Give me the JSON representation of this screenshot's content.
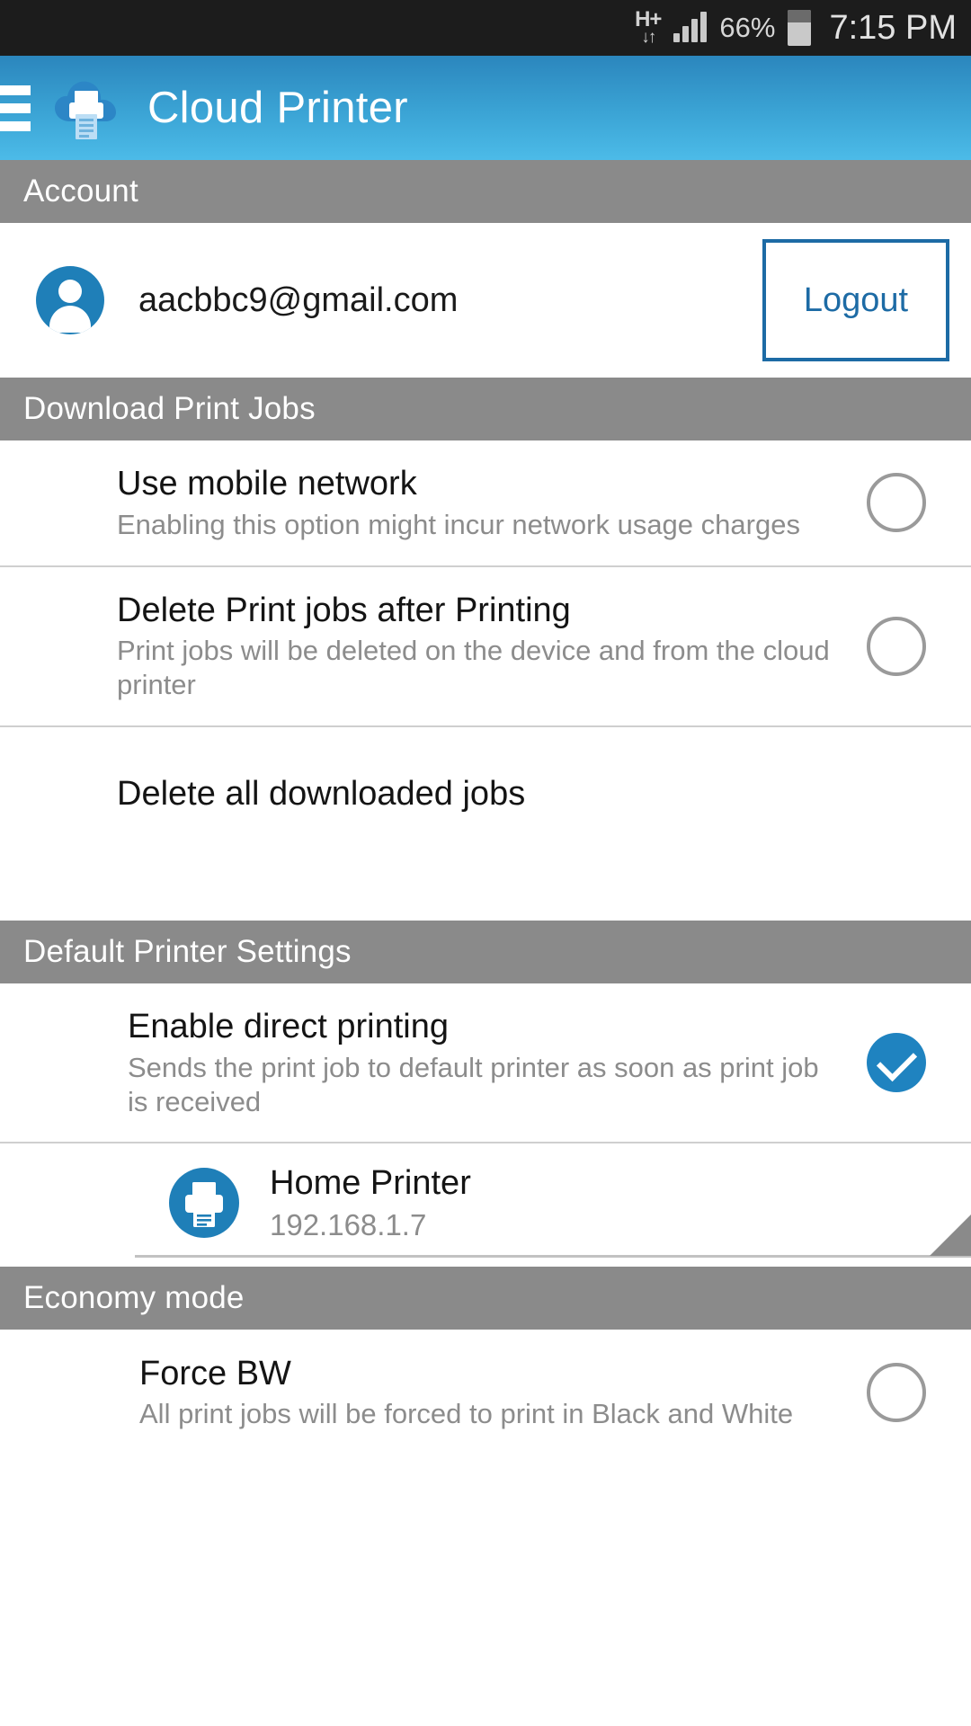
{
  "statusbar": {
    "network_type": "H+",
    "network_arrows": "↓↑",
    "battery_percent": "66%",
    "time": "7:15 PM"
  },
  "appbar": {
    "title": "Cloud Printer",
    "menu_icon": "hamburger-menu-icon",
    "logo_icon": "cloud-printer-logo-icon"
  },
  "sections": {
    "account": {
      "header": "Account",
      "email": "aacbbc9@gmail.com",
      "logout_label": "Logout",
      "avatar_icon": "user-avatar-icon",
      "accent_color": "#1d6ba5"
    },
    "download_print_jobs": {
      "header": "Download Print Jobs",
      "items": [
        {
          "title": "Use mobile network",
          "subtitle": "Enabling this option might incur network usage charges",
          "checked": false
        },
        {
          "title": "Delete Print jobs after Printing",
          "subtitle": "Print jobs will be deleted on the device and from the cloud printer",
          "checked": false
        }
      ],
      "action": "Delete all downloaded jobs"
    },
    "default_printer_settings": {
      "header": "Default Printer Settings",
      "items": [
        {
          "title": "Enable direct printing",
          "subtitle": "Sends the print job to default printer as soon as print job is received",
          "checked": true
        }
      ],
      "printer": {
        "name": "Home Printer",
        "ip": "192.168.1.7",
        "icon": "printer-icon"
      }
    },
    "economy_mode": {
      "header": "Economy mode",
      "items": [
        {
          "title": "Force BW",
          "subtitle": "All print jobs will be forced to print in Black and White",
          "checked": false
        }
      ]
    }
  },
  "colors": {
    "appbar_top": "#2b86bd",
    "appbar_bottom": "#4cbbe8",
    "section_header_bg": "#8a8a8a",
    "accent_blue": "#1f83c0",
    "checkbox_off": "#9a9a9a"
  }
}
